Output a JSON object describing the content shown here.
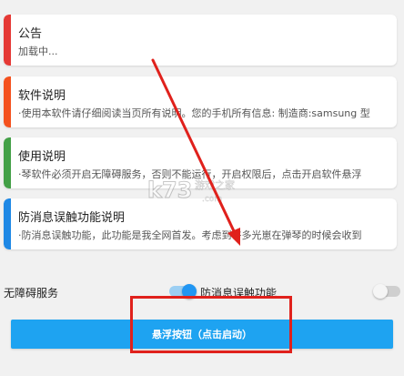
{
  "cards": [
    {
      "title": "公告",
      "desc": "加载中...",
      "color": "#e53935"
    },
    {
      "title": "软件说明",
      "desc": "·使用本软件请仔细阅读当页所有说明。您的手机所有信息: 制造商:samsung 型",
      "color": "#f4511e"
    },
    {
      "title": "使用说明",
      "desc": "·琴软件必须开启无障碍服务，否则不能运行，开启权限后，点击开启软件悬浮",
      "color": "#43a047"
    },
    {
      "title": "防消息误触功能说明",
      "desc": "·防消息误触功能，此功能是我全网首发。考虑到许多光崽在弹琴的时候会收到",
      "color": "#1e88e5"
    }
  ],
  "toggles": {
    "accessibility_label": "无障碍服务",
    "accessibility_on": true,
    "anti_mistouch_label": "防消息误触功能",
    "anti_mistouch_on": false
  },
  "float_button": {
    "label": "悬浮按钮（点击启动）"
  },
  "watermark": {
    "logo": "k73",
    "text": "游戏之家",
    "domain": ".com"
  },
  "colors": {
    "accent": "#1ea3f1",
    "annotation": "#e0211c"
  }
}
